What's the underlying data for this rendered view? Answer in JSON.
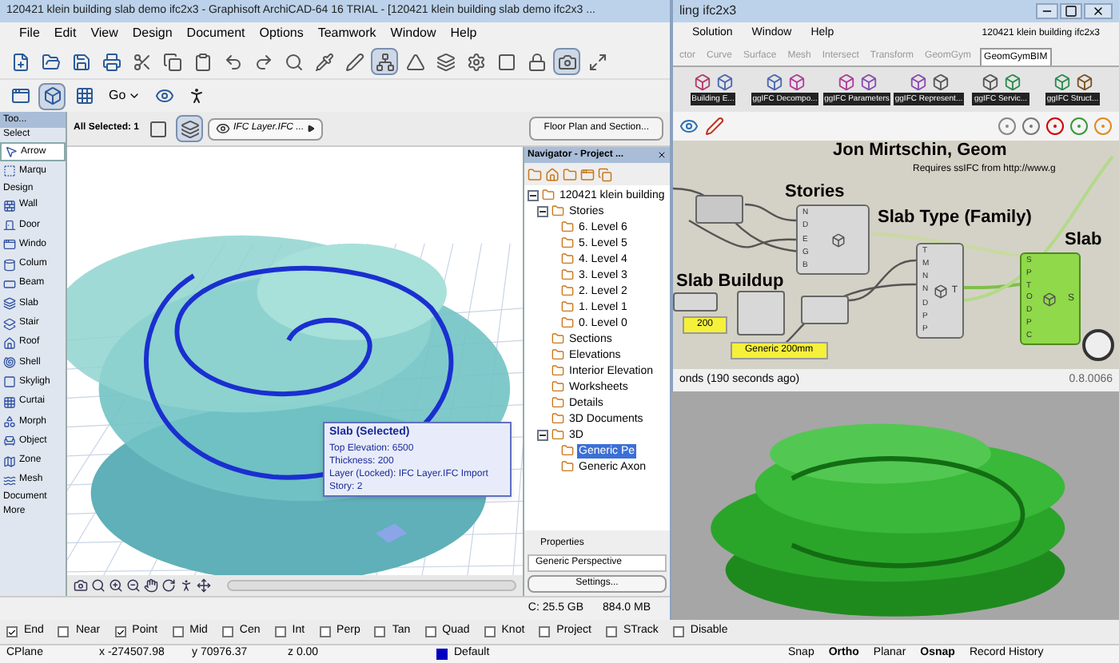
{
  "archicad": {
    "title": "120421 klein building slab demo ifc2x3 - Graphisoft ArchiCAD-64 16 TRIAL - [120421 klein building slab demo ifc2x3 ...",
    "menu": [
      "File",
      "Edit",
      "View",
      "Design",
      "Document",
      "Options",
      "Teamwork",
      "Window",
      "Help"
    ],
    "go_button": "Go",
    "toolbox": {
      "title": "Too...",
      "sections": [
        {
          "heading": "Select",
          "tools": [
            {
              "label": "Arrow",
              "selected": true
            },
            {
              "label": "Marqu",
              "selected": false
            }
          ]
        },
        {
          "heading": "Design",
          "tools": [
            {
              "label": "Wall",
              "selected": false
            },
            {
              "label": "Door",
              "selected": false
            },
            {
              "label": "Windo",
              "selected": false
            },
            {
              "label": "Colum",
              "selected": false
            },
            {
              "label": "Beam",
              "selected": false
            },
            {
              "label": "Slab",
              "selected": false
            },
            {
              "label": "Stair",
              "selected": false
            },
            {
              "label": "Roof",
              "selected": false
            },
            {
              "label": "Shell",
              "selected": false
            },
            {
              "label": "Skyligh",
              "selected": false
            },
            {
              "label": "Curtai",
              "selected": false
            },
            {
              "label": "Morph",
              "selected": false
            },
            {
              "label": "Object",
              "selected": false
            },
            {
              "label": "Zone",
              "selected": false
            },
            {
              "label": "Mesh",
              "selected": false
            }
          ]
        }
      ],
      "footer": [
        "Document",
        "More"
      ]
    },
    "info_box": {
      "selection": "All Selected: 1",
      "layer": "IFC Layer.IFC ...",
      "view_button": "Floor Plan and Section..."
    },
    "tooltip": {
      "title": "Slab (Selected)",
      "lines": [
        "Top Elevation: 6500",
        "Thickness: 200",
        "Layer (Locked): IFC Layer.IFC Import",
        "Story: 2"
      ]
    },
    "navigator": {
      "title": "Navigator - Project ...",
      "tree": [
        {
          "label": "120421 klein building",
          "expanded": true,
          "selected": false,
          "children": [
            {
              "label": "Stories",
              "expanded": true,
              "selected": false,
              "children": [
                {
                  "label": "6. Level 6",
                  "selected": false
                },
                {
                  "label": "5. Level 5",
                  "selected": false
                },
                {
                  "label": "4. Level 4",
                  "selected": false
                },
                {
                  "label": "3. Level 3",
                  "selected": false
                },
                {
                  "label": "2. Level 2",
                  "selected": false
                },
                {
                  "label": "1. Level 1",
                  "selected": false
                },
                {
                  "label": "0. Level 0",
                  "selected": false
                }
              ]
            },
            {
              "label": "Sections",
              "selected": false
            },
            {
              "label": "Elevations",
              "selected": false
            },
            {
              "label": "Interior Elevation",
              "selected": false
            },
            {
              "label": "Worksheets",
              "selected": false
            },
            {
              "label": "Details",
              "selected": false
            },
            {
              "label": "3D Documents",
              "selected": false
            },
            {
              "label": "3D",
              "expanded": true,
              "selected": false,
              "children": [
                {
                  "label": "Generic Pe",
                  "selected": true
                },
                {
                  "label": "Generic Axon",
                  "selected": false
                }
              ]
            }
          ]
        }
      ],
      "properties": {
        "heading": "Properties",
        "view_name": "Generic Perspective",
        "settings_button": "Settings..."
      }
    },
    "status": {
      "disk": "C: 25.5 GB",
      "memory": "884.0 MB"
    }
  },
  "grasshopper": {
    "title": "ling ifc2x3",
    "menu": [
      "Solution",
      "Window",
      "Help"
    ],
    "document": "120421 klein building ifc2x3",
    "tabs": [
      {
        "label": "ctor",
        "selected": false
      },
      {
        "label": "Curve",
        "selected": false
      },
      {
        "label": "Surface",
        "selected": false
      },
      {
        "label": "Mesh",
        "selected": false
      },
      {
        "label": "Intersect",
        "selected": false
      },
      {
        "label": "Transform",
        "selected": false
      },
      {
        "label": "GeomGym",
        "selected": false
      },
      {
        "label": "GeomGymBIM",
        "selected": true
      }
    ],
    "groups": [
      "Building E...",
      "ggIFC Decompo...",
      "ggIFC Parameters",
      "ggIFC Represent...",
      "ggIFC Servic...",
      "ggIFC Struct..."
    ],
    "canvas": {
      "author": "Jon Mirtschin, Geom",
      "note": "Requires ssIFC from http://www.g",
      "labels": [
        "Stories",
        "Slab Type (Family)",
        "Slab",
        "Slab Buildup"
      ],
      "stories_node": {
        "inputs": [
          "N",
          "D",
          "E",
          "G",
          "B"
        ]
      },
      "slab_type_node": {
        "inputs": [
          "T",
          "M",
          "N",
          "N",
          "D",
          "P",
          "P"
        ],
        "output": "T"
      },
      "slab_node": {
        "inputs": [
          "S",
          "P",
          "T",
          "O",
          "D",
          "P",
          "C"
        ],
        "output": "S"
      },
      "panels": [
        "200",
        "Generic 200mm"
      ]
    },
    "status": "onds (190 seconds ago)",
    "version": "0.8.0066"
  },
  "osnap": [
    {
      "label": "End",
      "checked": true
    },
    {
      "label": "Near",
      "checked": false
    },
    {
      "label": "Point",
      "checked": true
    },
    {
      "label": "Mid",
      "checked": false
    },
    {
      "label": "Cen",
      "checked": false
    },
    {
      "label": "Int",
      "checked": false
    },
    {
      "label": "Perp",
      "checked": false
    },
    {
      "label": "Tan",
      "checked": false
    },
    {
      "label": "Quad",
      "checked": false
    },
    {
      "label": "Knot",
      "checked": false
    },
    {
      "label": "Project",
      "checked": false
    },
    {
      "label": "STrack",
      "checked": false
    },
    {
      "label": "Disable",
      "checked": false
    }
  ],
  "status_bar": {
    "plane": "CPlane",
    "x": "x -274507.98",
    "y": "y 70976.37",
    "z": "z 0.00",
    "layer": "Default",
    "toggles": [
      {
        "label": "Snap",
        "on": false
      },
      {
        "label": "Ortho",
        "on": true
      },
      {
        "label": "Planar",
        "on": false
      },
      {
        "label": "Osnap",
        "on": true
      },
      {
        "label": "Record History",
        "on": false
      }
    ]
  }
}
